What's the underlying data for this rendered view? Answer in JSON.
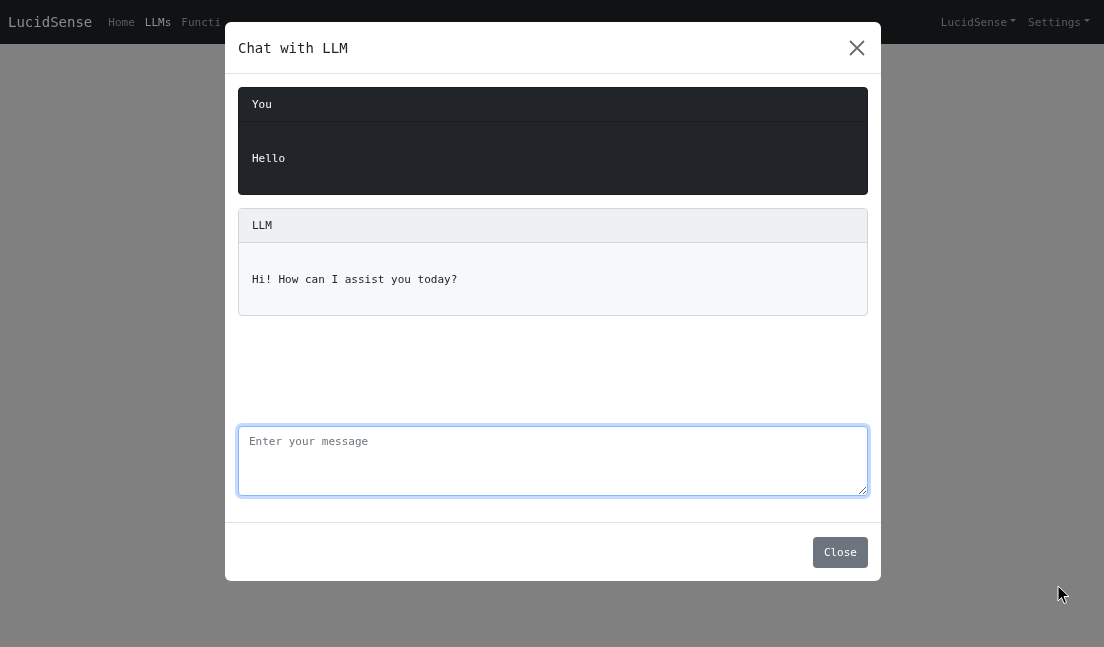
{
  "navbar": {
    "brand": "LucidSense",
    "links": [
      {
        "label": "Home",
        "selected": false
      },
      {
        "label": "LLMs",
        "selected": true
      },
      {
        "label": "Functi",
        "selected": false
      }
    ],
    "menus": [
      "LucidSense",
      "Settings"
    ]
  },
  "modal": {
    "title": "Chat with LLM",
    "messages": [
      {
        "kind": "user",
        "sender": "You",
        "text": "Hello"
      },
      {
        "kind": "assistant",
        "sender": "LLM",
        "text": "Hi! How can I assist you today?"
      }
    ],
    "input": {
      "placeholder": "Enter your message"
    },
    "buttons": [
      "Close"
    ]
  }
}
